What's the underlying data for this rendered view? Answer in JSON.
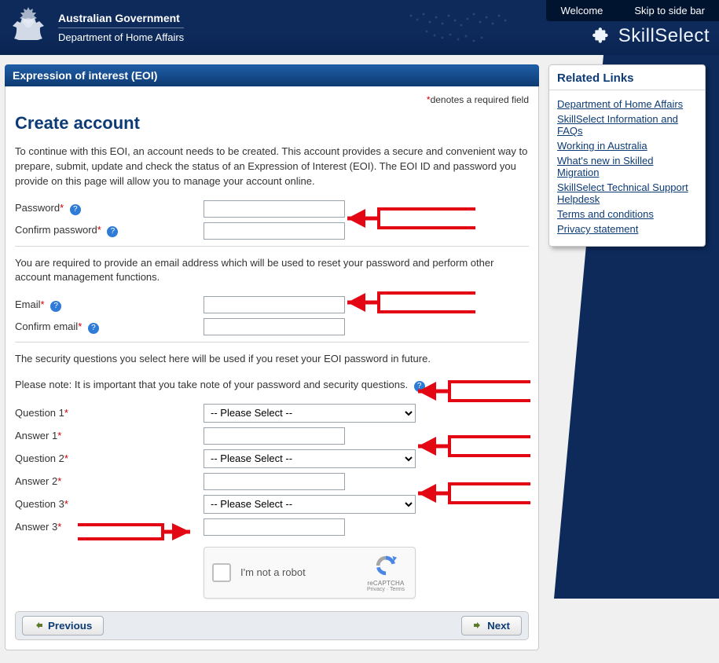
{
  "gov": {
    "line1": "Australian Government",
    "line2": "Department of Home Affairs"
  },
  "toplinks": {
    "welcome": "Welcome",
    "skip": "Skip to side bar"
  },
  "brand": "SkillSelect",
  "panel_title": "Expression of interest (EOI)",
  "required_note_prefix": "*",
  "required_note": "denotes a required field",
  "heading": "Create account",
  "intro": "To continue with this EOI, an account needs to be created. This account provides a secure and convenient way to prepare, submit, update and check the status of an Expression of Interest (EOI). The EOI ID and password you provide on this page will allow you to manage your account online.",
  "labels": {
    "password": "Password",
    "confirm_password": "Confirm password",
    "email": "Email",
    "confirm_email": "Confirm email",
    "question1": "Question 1",
    "answer1": "Answer 1",
    "question2": "Question 2",
    "answer2": "Answer 2",
    "question3": "Question 3",
    "answer3": "Answer 3"
  },
  "section_email_intro": "You are required to provide an email address which will be used to reset your password and perform other account management functions.",
  "section_security_intro": "The security questions you select here will be used if you reset your EOI password in future.",
  "section_security_note": "Please note: It is important that you take note of your password and security questions.",
  "select_placeholder": "-- Please Select --",
  "captcha": {
    "label": "I'm not a robot",
    "brand": "reCAPTCHA",
    "privacy": "Privacy",
    "terms": "Terms"
  },
  "buttons": {
    "previous": "Previous",
    "next": "Next"
  },
  "side_title": "Related Links",
  "side_links": [
    "Department of Home Affairs",
    "SkillSelect Information and FAQs",
    "Working in Australia",
    "What's new in Skilled Migration",
    "SkillSelect Technical Support Helpdesk",
    "Terms and conditions",
    "Privacy statement"
  ]
}
